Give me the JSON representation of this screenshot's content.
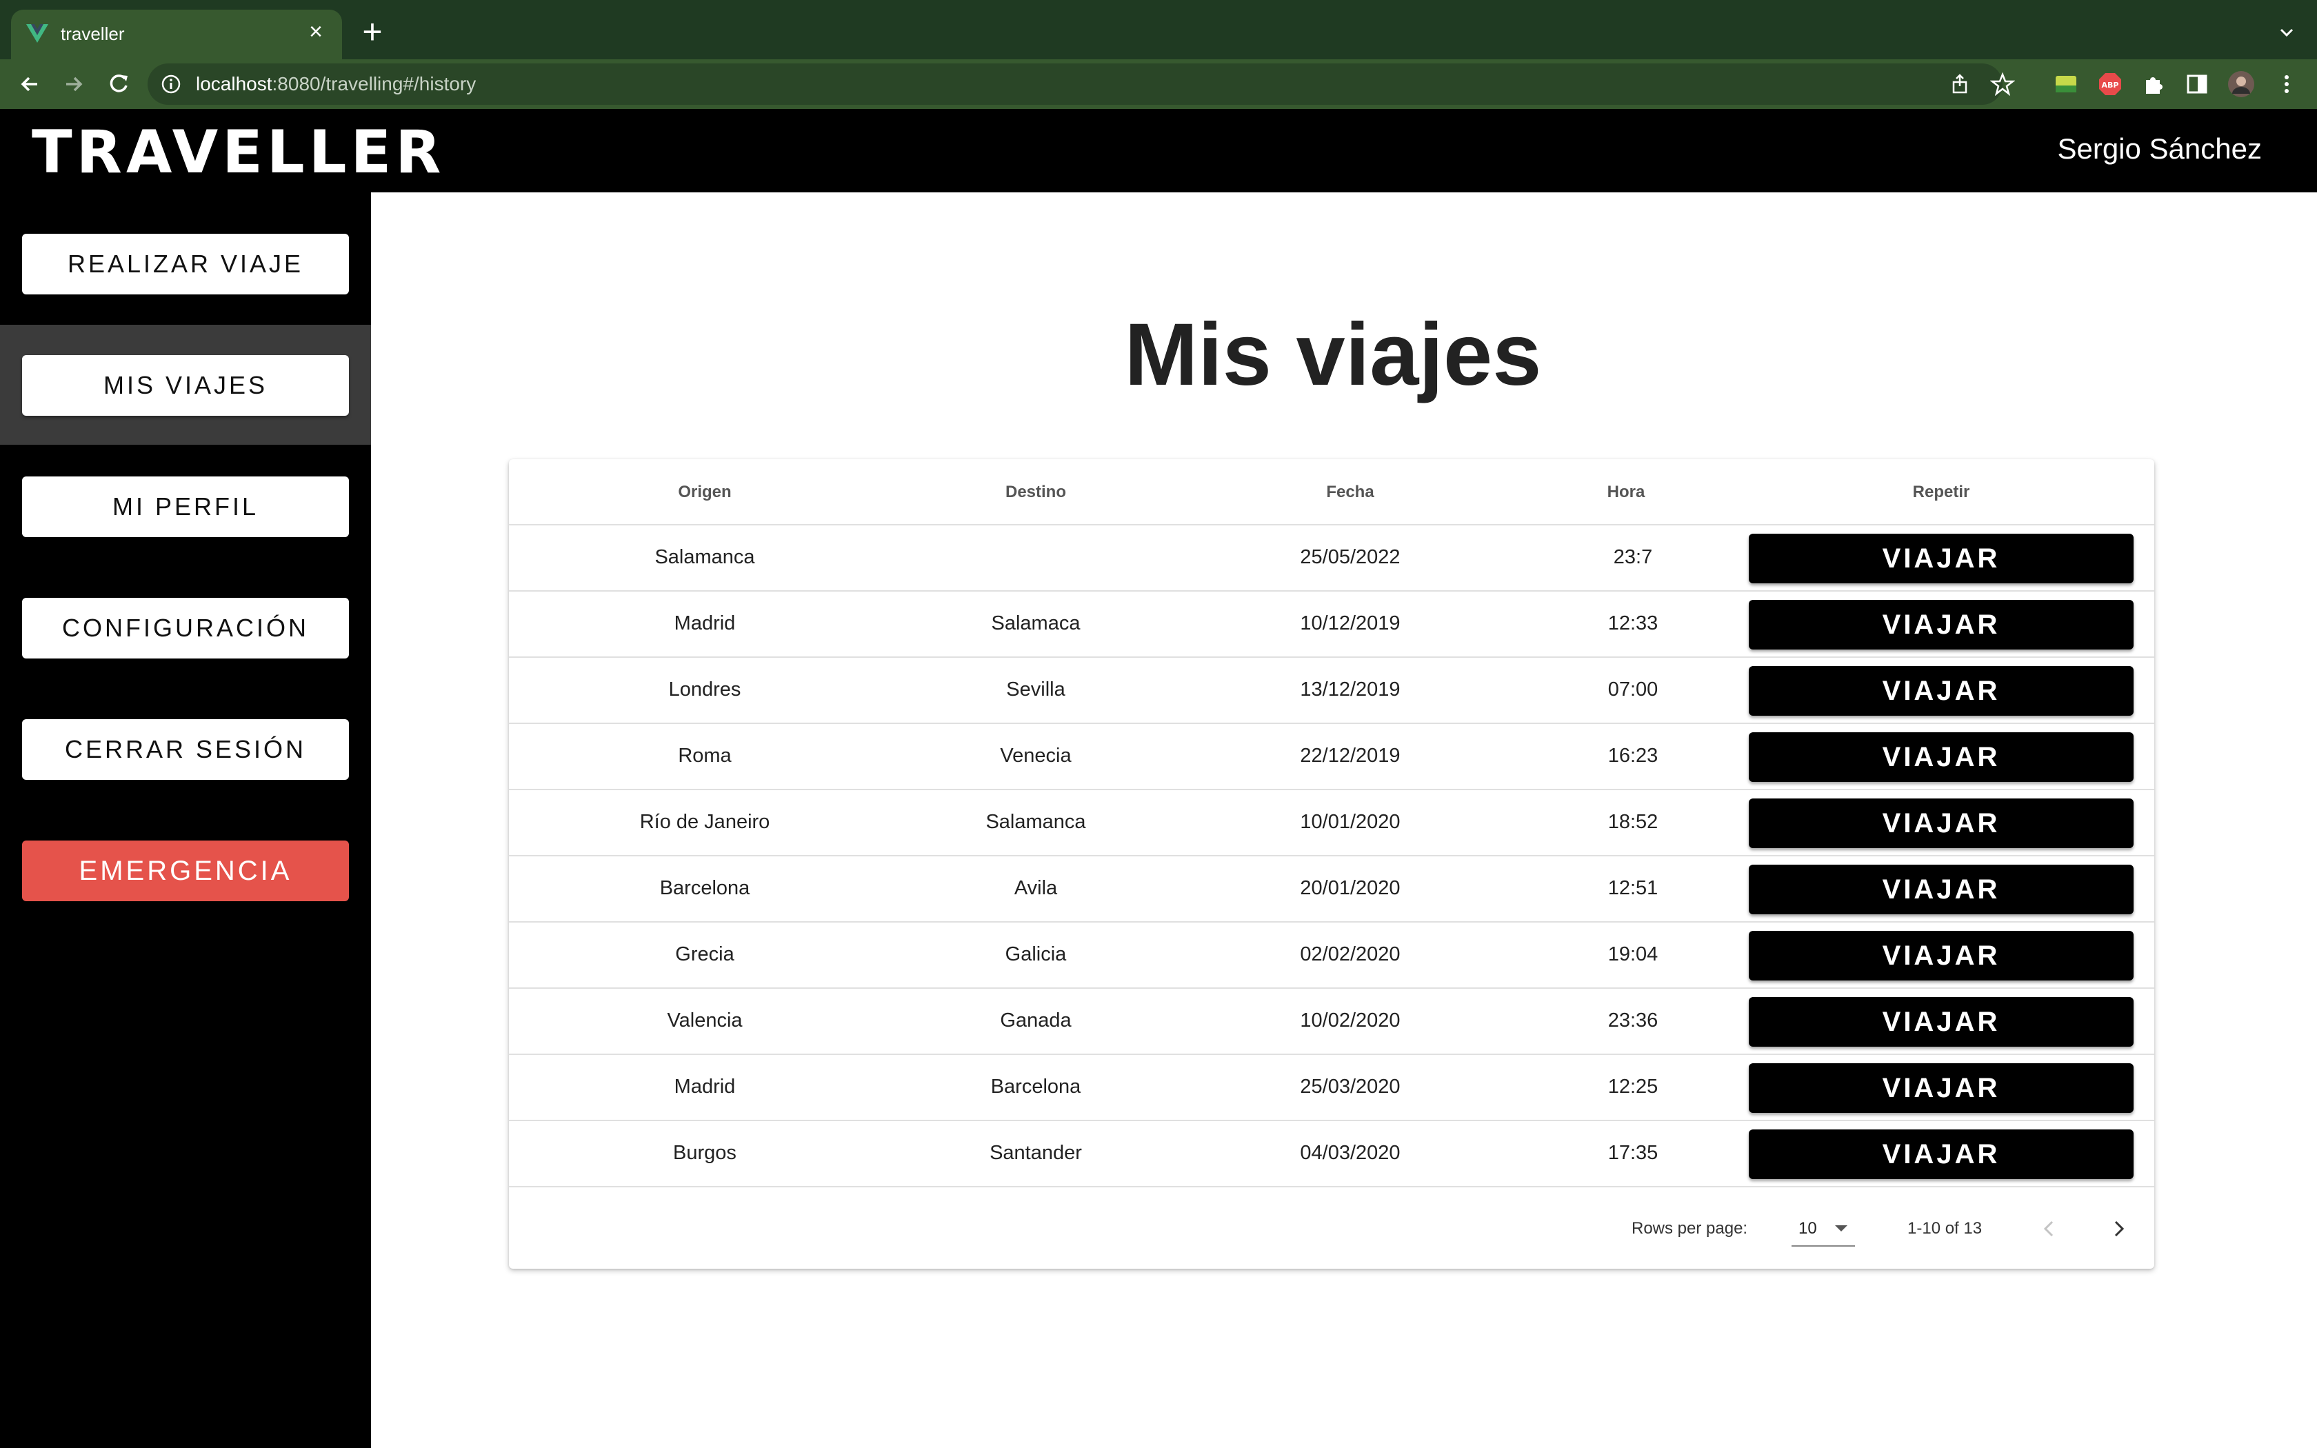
{
  "browser": {
    "tab_title": "traveller",
    "url_host": "localhost",
    "url_rest": ":8080/travelling#/history"
  },
  "app": {
    "logo": "TRAVELLER",
    "user_name": "Sergio Sánchez"
  },
  "sidebar": {
    "items": [
      {
        "label": "REALIZAR VIAJE"
      },
      {
        "label": "MIS VIAJES",
        "active": true
      },
      {
        "label": "MI PERFIL"
      },
      {
        "label": "CONFIGURACIÓN"
      },
      {
        "label": "CERRAR SESIÓN"
      },
      {
        "label": "EMERGENCIA",
        "color": "#e5534b"
      }
    ]
  },
  "main": {
    "title": "Mis viajes"
  },
  "table": {
    "headers": {
      "origen": "Origen",
      "destino": "Destino",
      "fecha": "Fecha",
      "hora": "Hora",
      "repetir": "Repetir"
    },
    "button_label": "VIAJAR",
    "rows": [
      {
        "origen": "Salamanca",
        "destino": "",
        "fecha": "25/05/2022",
        "hora": "23:7"
      },
      {
        "origen": "Madrid",
        "destino": "Salamaca",
        "fecha": "10/12/2019",
        "hora": "12:33"
      },
      {
        "origen": "Londres",
        "destino": "Sevilla",
        "fecha": "13/12/2019",
        "hora": "07:00"
      },
      {
        "origen": "Roma",
        "destino": "Venecia",
        "fecha": "22/12/2019",
        "hora": "16:23"
      },
      {
        "origen": "Río de Janeiro",
        "destino": "Salamanca",
        "fecha": "10/01/2020",
        "hora": "18:52"
      },
      {
        "origen": "Barcelona",
        "destino": "Avila",
        "fecha": "20/01/2020",
        "hora": "12:51"
      },
      {
        "origen": "Grecia",
        "destino": "Galicia",
        "fecha": "02/02/2020",
        "hora": "19:04"
      },
      {
        "origen": "Valencia",
        "destino": "Ganada",
        "fecha": "10/02/2020",
        "hora": "23:36"
      },
      {
        "origen": "Madrid",
        "destino": "Barcelona",
        "fecha": "25/03/2020",
        "hora": "12:25"
      },
      {
        "origen": "Burgos",
        "destino": "Santander",
        "fecha": "04/03/2020",
        "hora": "17:35"
      }
    ],
    "footer": {
      "rows_per_page_label": "Rows per page:",
      "rows_per_page_value": "10",
      "page_info": "1-10 of 13"
    }
  },
  "colors": {
    "accent": "#000000",
    "emergency": "#e5534b",
    "active_nav_bg": "#3b3b3b"
  }
}
